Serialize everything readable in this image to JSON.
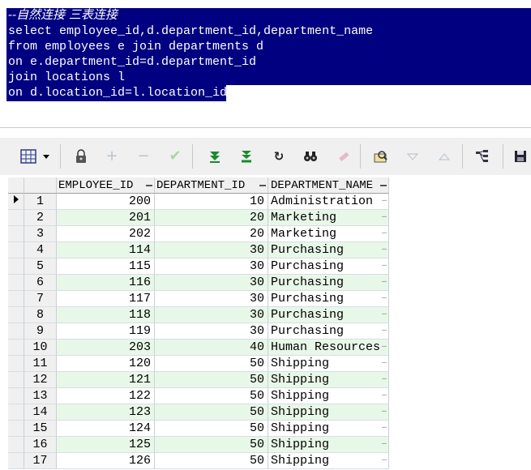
{
  "editor": {
    "lines": [
      "--自然连接 三表连接",
      "select employee_id,d.department_id,department_name",
      "from employees e join departments d",
      "on e.department_id=d.department_id",
      "join locations l",
      "on d.location_id=l.location_id"
    ]
  },
  "toolbar": {
    "icons": [
      "grid-view-icon",
      "dropdown-arrow-icon",
      "lock-icon",
      "plus-icon",
      "minus-icon",
      "check-icon",
      "fetch-next-icon",
      "fetch-last-icon",
      "refresh-icon",
      "find-icon",
      "clear-icon",
      "query-by-example-icon",
      "filter-down-icon",
      "filter-up-icon",
      "explain-icon",
      "save-icon"
    ]
  },
  "grid": {
    "columns": [
      "EMPLOYEE_ID",
      "DEPARTMENT_ID",
      "DEPARTMENT_NAME"
    ],
    "rows": [
      {
        "n": "1",
        "emp": "200",
        "dep": "10",
        "name": "Administration"
      },
      {
        "n": "2",
        "emp": "201",
        "dep": "20",
        "name": "Marketing"
      },
      {
        "n": "3",
        "emp": "202",
        "dep": "20",
        "name": "Marketing"
      },
      {
        "n": "4",
        "emp": "114",
        "dep": "30",
        "name": "Purchasing"
      },
      {
        "n": "5",
        "emp": "115",
        "dep": "30",
        "name": "Purchasing"
      },
      {
        "n": "6",
        "emp": "116",
        "dep": "30",
        "name": "Purchasing"
      },
      {
        "n": "7",
        "emp": "117",
        "dep": "30",
        "name": "Purchasing"
      },
      {
        "n": "8",
        "emp": "118",
        "dep": "30",
        "name": "Purchasing"
      },
      {
        "n": "9",
        "emp": "119",
        "dep": "30",
        "name": "Purchasing"
      },
      {
        "n": "10",
        "emp": "203",
        "dep": "40",
        "name": "Human Resources"
      },
      {
        "n": "11",
        "emp": "120",
        "dep": "50",
        "name": "Shipping"
      },
      {
        "n": "12",
        "emp": "121",
        "dep": "50",
        "name": "Shipping"
      },
      {
        "n": "13",
        "emp": "122",
        "dep": "50",
        "name": "Shipping"
      },
      {
        "n": "14",
        "emp": "123",
        "dep": "50",
        "name": "Shipping"
      },
      {
        "n": "15",
        "emp": "124",
        "dep": "50",
        "name": "Shipping"
      },
      {
        "n": "16",
        "emp": "125",
        "dep": "50",
        "name": "Shipping"
      },
      {
        "n": "17",
        "emp": "126",
        "dep": "50",
        "name": "Shipping"
      }
    ]
  }
}
